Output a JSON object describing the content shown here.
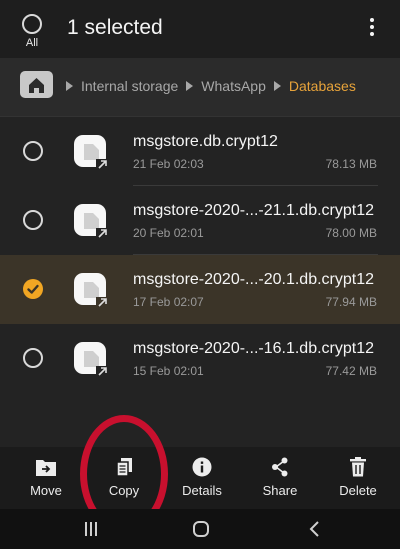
{
  "header": {
    "all_label": "All",
    "title": "1 selected"
  },
  "breadcrumb": {
    "items": [
      "Internal storage",
      "WhatsApp",
      "Databases"
    ],
    "accent": "#e7a33a"
  },
  "files": [
    {
      "name": "msgstore.db.crypt12",
      "date": "21 Feb 02:03",
      "size": "78.13 MB",
      "selected": false
    },
    {
      "name": "msgstore-2020-...-21.1.db.crypt12",
      "date": "20 Feb 02:01",
      "size": "78.00 MB",
      "selected": false
    },
    {
      "name": "msgstore-2020-...-20.1.db.crypt12",
      "date": "17 Feb 02:07",
      "size": "77.94 MB",
      "selected": true
    },
    {
      "name": "msgstore-2020-...-16.1.db.crypt12",
      "date": "15 Feb 02:01",
      "size": "77.42 MB",
      "selected": false
    }
  ],
  "actions": {
    "move": "Move",
    "copy": "Copy",
    "details": "Details",
    "share": "Share",
    "delete": "Delete"
  },
  "colors": {
    "selected_check": "#f1a623",
    "annotation": "#c8102e"
  }
}
